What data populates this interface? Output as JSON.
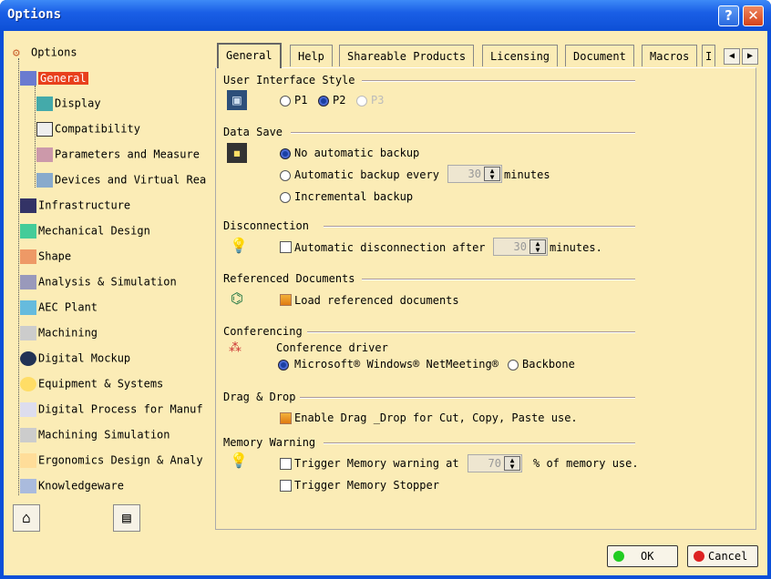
{
  "window": {
    "title": "Options"
  },
  "titlebar": {
    "help_glyph": "?",
    "close_glyph": "✕"
  },
  "tree": {
    "root": "Options",
    "items": [
      {
        "label": "General",
        "selected": true
      },
      {
        "label": "Display"
      },
      {
        "label": "Compatibility"
      },
      {
        "label": "Parameters and Measure"
      },
      {
        "label": "Devices and Virtual Rea"
      },
      {
        "label": "Infrastructure"
      },
      {
        "label": "Mechanical Design"
      },
      {
        "label": "Shape"
      },
      {
        "label": "Analysis & Simulation"
      },
      {
        "label": "AEC Plant"
      },
      {
        "label": "Machining"
      },
      {
        "label": "Digital Mockup"
      },
      {
        "label": "Equipment & Systems"
      },
      {
        "label": "Digital Process for Manuf"
      },
      {
        "label": "Machining Simulation"
      },
      {
        "label": "Ergonomics Design & Analy"
      },
      {
        "label": "Knowledgeware"
      }
    ]
  },
  "tabs": [
    "General",
    "Help",
    "Shareable Products",
    "Licensing",
    "Document",
    "Macros",
    "I"
  ],
  "ui_style": {
    "title": "User Interface Style",
    "p1": "P1",
    "p2": "P2",
    "p3": "P3"
  },
  "data_save": {
    "title": "Data Save",
    "no_backup": "No automatic backup",
    "auto_backup": "Automatic backup every",
    "auto_value": "30",
    "minutes": "minutes",
    "incremental": "Incremental backup"
  },
  "disconnection": {
    "title": "Disconnection",
    "auto": "Automatic disconnection after",
    "value": "30",
    "minutes": "minutes."
  },
  "referenced": {
    "title": "Referenced Documents",
    "load": "Load referenced documents"
  },
  "conferencing": {
    "title": "Conferencing",
    "driver": "Conference driver",
    "microsoft": "Microsoft® Windows® NetMeeting®",
    "backbone": "Backbone"
  },
  "drag_drop": {
    "title": "Drag & Drop",
    "enable": "Enable Drag _Drop for Cut, Copy, Paste use."
  },
  "memory": {
    "title": "Memory Warning",
    "trigger": "Trigger Memory warning at",
    "value": "70",
    "pct": "% of memory use.",
    "stopper": "Trigger Memory Stopper"
  },
  "buttons": {
    "ok": "OK",
    "cancel": "Cancel"
  },
  "colors": {
    "titlebar": "#0d4fd6",
    "background": "#fbecb6",
    "selection": "#e8401c"
  }
}
